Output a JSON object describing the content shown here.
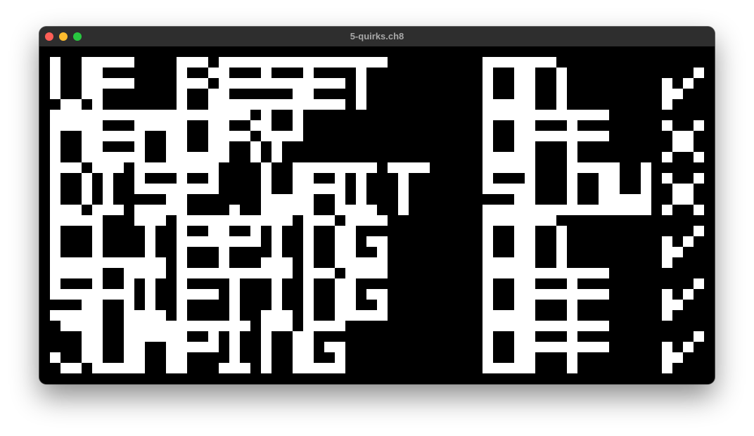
{
  "window": {
    "title": "5-quirks.ch8",
    "traffic_colors": {
      "close": "#ff5f57",
      "minimize": "#febc2e",
      "zoom": "#28c840"
    }
  },
  "screen": {
    "background": "#000000",
    "pixel_color": "#ffffff"
  },
  "quirks": [
    {
      "name": "VF RESET",
      "value": "ON",
      "result": "check-icon"
    },
    {
      "name": "MEMORY",
      "value": "OFF",
      "result": "cross-icon"
    },
    {
      "name": "DISP.WAIT",
      "value": "SLOW",
      "result": "cross-icon"
    },
    {
      "name": "CLIPPING",
      "value": "ON",
      "result": "check-icon"
    },
    {
      "name": "SHIFTING",
      "value": "OFF",
      "result": "check-icon"
    },
    {
      "name": "JUMPING",
      "value": "OFF",
      "result": "check-icon"
    }
  ]
}
